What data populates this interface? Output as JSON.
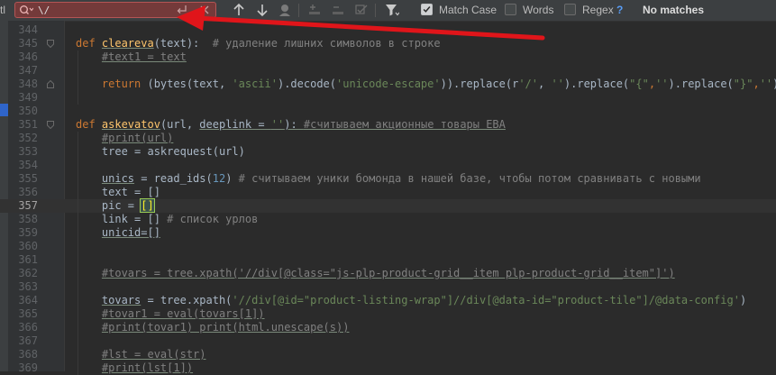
{
  "findbar": {
    "edge_text": "tl",
    "search_value": "\\/",
    "options": [
      {
        "label": "Match Case",
        "checked": true
      },
      {
        "label": "Words",
        "checked": false
      },
      {
        "label": "Regex",
        "checked": false
      }
    ],
    "help": "?",
    "status": "No matches",
    "icons": [
      "search-history-icon",
      "newline-icon",
      "clear-icon",
      "arrow-up-icon",
      "arrow-down-icon",
      "find-usages-icon",
      "add-occurrence-icon",
      "remove-occurrence-icon",
      "select-all-occurrences-icon",
      "filter-icon"
    ]
  },
  "editor": {
    "current_line": 357,
    "lines": [
      {
        "n": 344,
        "segs": []
      },
      {
        "n": 345,
        "segs": [
          [
            "kw",
            "def "
          ],
          [
            "fn und",
            "cleareva"
          ],
          [
            "",
            "(text):  "
          ],
          [
            "cm",
            "# удаление лишних символов в строке"
          ]
        ]
      },
      {
        "n": 346,
        "segs": [
          [
            "",
            "    "
          ],
          [
            "cm und",
            "#text1 = text"
          ]
        ]
      },
      {
        "n": 347,
        "segs": []
      },
      {
        "n": 348,
        "segs": [
          [
            "",
            "    "
          ],
          [
            "kw",
            "return "
          ],
          [
            "",
            "(bytes(text, "
          ],
          [
            "str",
            "'ascii'"
          ],
          [
            "",
            ").decode("
          ],
          [
            "str",
            "'unicode-escape'"
          ],
          [
            "",
            ")).replace(r"
          ],
          [
            "str",
            "'/'"
          ],
          [
            "",
            ", "
          ],
          [
            "str",
            "''"
          ],
          [
            "",
            ").replace("
          ],
          [
            "str",
            "\"{\""
          ],
          [
            "kw",
            ","
          ],
          [
            "str",
            "''"
          ],
          [
            "",
            ").replace("
          ],
          [
            "str",
            "\"}\""
          ],
          [
            "kw",
            ","
          ],
          [
            "str",
            "''"
          ],
          [
            "",
            ")"
          ]
        ]
      },
      {
        "n": 349,
        "segs": []
      },
      {
        "n": 350,
        "segs": []
      },
      {
        "n": 351,
        "segs": [
          [
            "kw",
            "def "
          ],
          [
            "fn und",
            "askevatov"
          ],
          [
            "",
            "(url, "
          ],
          [
            "und",
            "deeplink = "
          ],
          [
            "str und",
            "''"
          ],
          [
            "und",
            "): "
          ],
          [
            "cm und",
            "#считываем акционные товары EBA"
          ]
        ]
      },
      {
        "n": 352,
        "segs": [
          [
            "",
            "    "
          ],
          [
            "cm und",
            "#print(url)"
          ]
        ]
      },
      {
        "n": 353,
        "segs": [
          [
            "",
            "    tree = askrequest(url)"
          ]
        ]
      },
      {
        "n": 354,
        "segs": []
      },
      {
        "n": 355,
        "segs": [
          [
            "",
            "    "
          ],
          [
            "und",
            "unics"
          ],
          [
            "",
            " = read_ids("
          ],
          [
            "num",
            "12"
          ],
          [
            "",
            ") "
          ],
          [
            "cm",
            "# считываем уники бомонда в нашей базе, чтобы потом сравнивать с новыми"
          ]
        ]
      },
      {
        "n": 356,
        "segs": [
          [
            "",
            "    text = []"
          ]
        ]
      },
      {
        "n": 357,
        "segs": [
          [
            "",
            "    pic = "
          ],
          [
            "bm",
            "[]"
          ]
        ]
      },
      {
        "n": 358,
        "segs": [
          [
            "",
            "    link = [] "
          ],
          [
            "cm",
            "# список урлов"
          ]
        ]
      },
      {
        "n": 359,
        "segs": [
          [
            "",
            "    "
          ],
          [
            "und",
            "unicid=[]"
          ]
        ]
      },
      {
        "n": 360,
        "segs": []
      },
      {
        "n": 361,
        "segs": []
      },
      {
        "n": 362,
        "segs": [
          [
            "",
            "    "
          ],
          [
            "cm und",
            "#tovars = tree.xpath('//div[@class=\"js-plp-product-grid__item plp-product-grid__item\"]')"
          ]
        ]
      },
      {
        "n": 363,
        "segs": []
      },
      {
        "n": 364,
        "segs": [
          [
            "",
            "    "
          ],
          [
            "und",
            "tovars"
          ],
          [
            "",
            " = tree.xpath("
          ],
          [
            "str",
            "'//div[@id=\"product-listing-wrap\"]//div[@data-id=\"product-tile\"]/@data-config'"
          ],
          [
            "",
            ")"
          ]
        ]
      },
      {
        "n": 365,
        "segs": [
          [
            "",
            "    "
          ],
          [
            "cm und",
            "#tovar1 = eval(tovars[1])"
          ]
        ]
      },
      {
        "n": 366,
        "segs": [
          [
            "",
            "    "
          ],
          [
            "cm und",
            "#print(tovar1) print(html.unescape(s))"
          ]
        ]
      },
      {
        "n": 367,
        "segs": []
      },
      {
        "n": 368,
        "segs": [
          [
            "",
            "    "
          ],
          [
            "cm und",
            "#lst = eval(str)"
          ]
        ]
      },
      {
        "n": 369,
        "segs": [
          [
            "",
            "    "
          ],
          [
            "cm und",
            "#print(lst[1])"
          ]
        ]
      }
    ]
  },
  "colors": {
    "search_error_bg": "#743a3a",
    "annotation_arrow": "#e0151a",
    "keyword": "#cc7832",
    "function": "#ffc66d",
    "string": "#6a8759",
    "number": "#6897bb",
    "comment": "#808080"
  }
}
